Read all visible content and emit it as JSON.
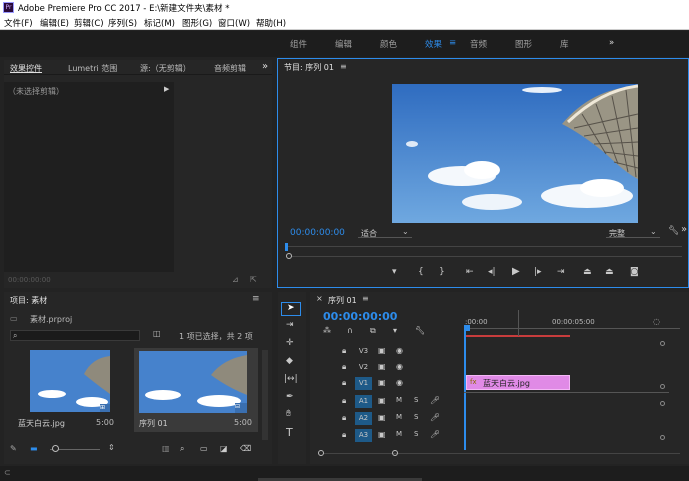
{
  "window": {
    "title": "Adobe Premiere Pro CC 2017 - E:\\新建文件夹\\素材 *",
    "app_badge": "Pr"
  },
  "menu": [
    "文件(F)",
    "编辑(E)",
    "剪辑(C)",
    "序列(S)",
    "标记(M)",
    "图形(G)",
    "窗口(W)",
    "帮助(H)"
  ],
  "workspaces": [
    "组件",
    "编辑",
    "颜色",
    "效果",
    "音频",
    "图形",
    "库"
  ],
  "active_workspace": "效果",
  "left_panel": {
    "tabs": [
      "效果控件",
      "Lumetri 范围",
      "源:（无剪辑）",
      "音频剪辑"
    ],
    "no_clip": "（未选择剪辑）",
    "timecode": "00:00:00:00"
  },
  "program": {
    "title": "节目: 序列 01",
    "timecode": "00:00:00:00",
    "fit": "适合",
    "quality": "完整"
  },
  "project": {
    "title": "项目: 素材",
    "file": "素材.prproj",
    "selection": "1 项已选择，共 2 项",
    "items": [
      {
        "name": "蓝天白云.jpg",
        "duration": "5:00"
      },
      {
        "name": "序列 01",
        "duration": "5:00"
      }
    ]
  },
  "timeline": {
    "tab": "序列 01",
    "timecode": "00:00:00:00",
    "ruler": [
      ":00:00",
      "00:00:05:00"
    ],
    "video_tracks": [
      "V3",
      "V2",
      "V1"
    ],
    "audio_tracks": [
      "A1",
      "A2",
      "A3"
    ],
    "clip": "蓝天白云.jpg"
  },
  "colors": {
    "accent": "#2d8ceb",
    "clip": "#e08ae6",
    "sky": "#3f7fc9"
  }
}
